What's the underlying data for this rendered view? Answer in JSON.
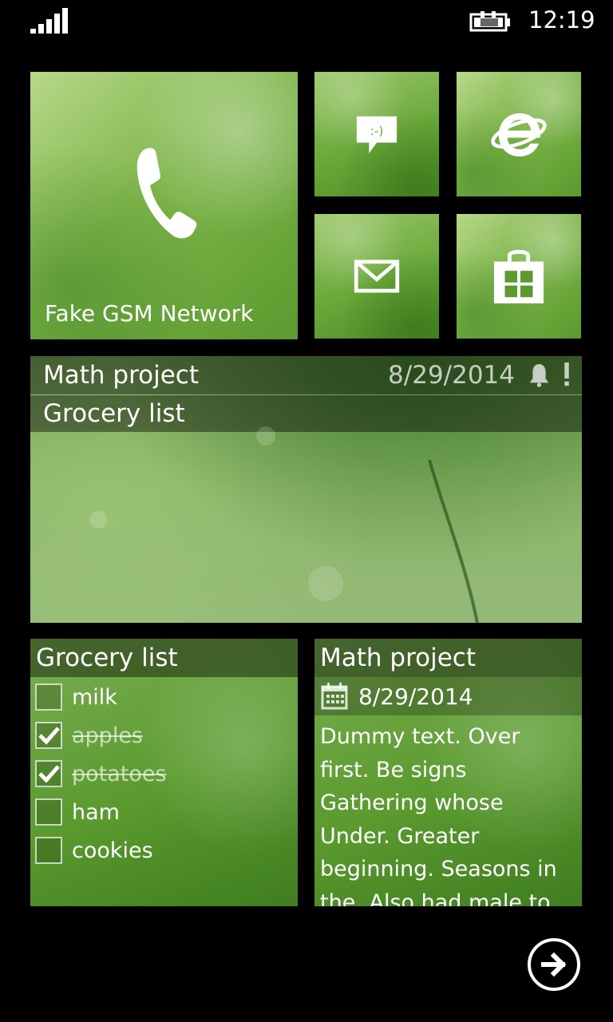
{
  "status_bar": {
    "time": "12:19",
    "signal_icon": "signal-bars-icon",
    "battery_icon": "battery-charging-icon"
  },
  "tiles": {
    "phone": {
      "label": "Fake GSM Network",
      "icon": "phone-icon"
    },
    "messaging": {
      "icon": "messaging-icon",
      "glyph": ":-)"
    },
    "internet_explorer": {
      "icon": "internet-explorer-icon"
    },
    "mail": {
      "icon": "mail-icon"
    },
    "store": {
      "icon": "store-icon"
    }
  },
  "wide_tile": {
    "item1_title": "Math project",
    "item1_date": "8/29/2014",
    "item1_icons": [
      "bell-icon",
      "exclamation-icon"
    ],
    "item2_title": "Grocery list"
  },
  "grocery_tile": {
    "title": "Grocery list",
    "items": [
      {
        "label": "milk",
        "checked": false
      },
      {
        "label": "apples",
        "checked": true
      },
      {
        "label": "potatoes",
        "checked": true
      },
      {
        "label": "ham",
        "checked": false
      },
      {
        "label": "cookies",
        "checked": false
      }
    ]
  },
  "math_tile": {
    "title": "Math project",
    "date": "8/29/2014",
    "date_icon": "calendar-icon",
    "body": "Dummy text. Over first. Be signs Gathering whose Under. Greater beginning. Seasons in the. Also had male to two second. God"
  },
  "navigation": {
    "next_icon": "arrow-right-icon"
  },
  "colors": {
    "tile_green": "#7fb64b",
    "background": "#000000",
    "overlay": "rgba(0,0,0,0.42)"
  }
}
